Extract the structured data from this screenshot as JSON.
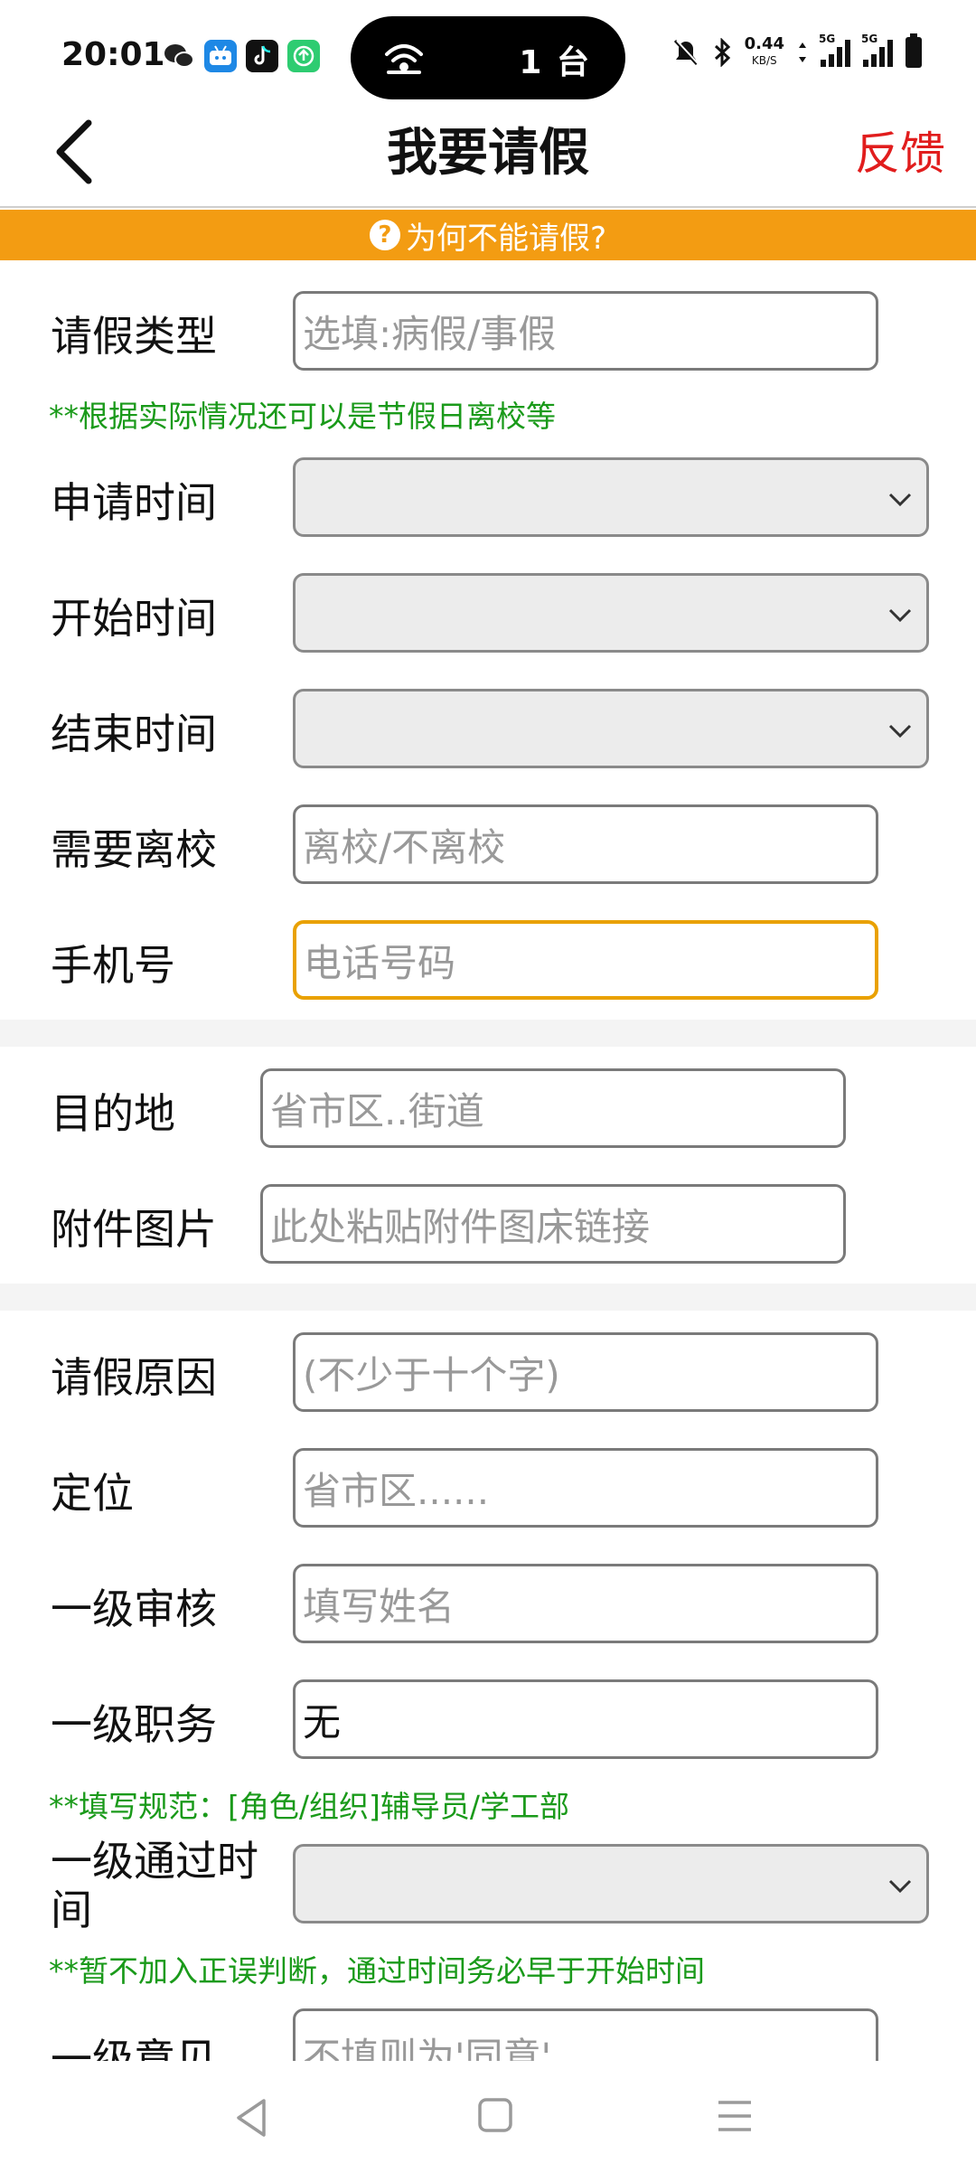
{
  "status_bar": {
    "time": "20:01",
    "island_text": "1 台",
    "speed_value": "0.44",
    "speed_unit": "KB/S",
    "sig1_tag": "5G",
    "sig2_tag": "5G"
  },
  "nav": {
    "title": "我要请假",
    "feedback": "反馈"
  },
  "banner": {
    "text": "为何不能请假?"
  },
  "form": {
    "leave_type": {
      "label": "请假类型",
      "placeholder": "选填:病假/事假"
    },
    "leave_type_note": "**根据实际情况还可以是节假日离校等",
    "apply_time": {
      "label": "申请时间"
    },
    "start_time": {
      "label": "开始时间"
    },
    "end_time": {
      "label": "结束时间"
    },
    "leave_school": {
      "label": "需要离校",
      "placeholder": "离校/不离校"
    },
    "phone": {
      "label": "手机号",
      "placeholder": "电话号码"
    },
    "destination": {
      "label": "目的地",
      "placeholder": "省市区..街道"
    },
    "attachment": {
      "label": "附件图片",
      "placeholder": "此处粘贴附件图床链接"
    },
    "reason": {
      "label": "请假原因",
      "placeholder": "(不少于十个字)"
    },
    "location": {
      "label": "定位",
      "placeholder": "省市区......"
    },
    "reviewer1": {
      "label": "一级审核",
      "placeholder": "填写姓名"
    },
    "reviewer1_title": {
      "label": "一级职务",
      "value": "无"
    },
    "reviewer1_title_note": "**填写规范：[角色/组织]辅导员/学工部",
    "reviewer1_pass_time": {
      "label": "一级通过时间"
    },
    "reviewer1_pass_time_note": "**暂不加入正误判断，通过时间务必早于开始时间",
    "reviewer1_opinion": {
      "label": "一级意见",
      "placeholder": "不填则为'同意'"
    }
  }
}
